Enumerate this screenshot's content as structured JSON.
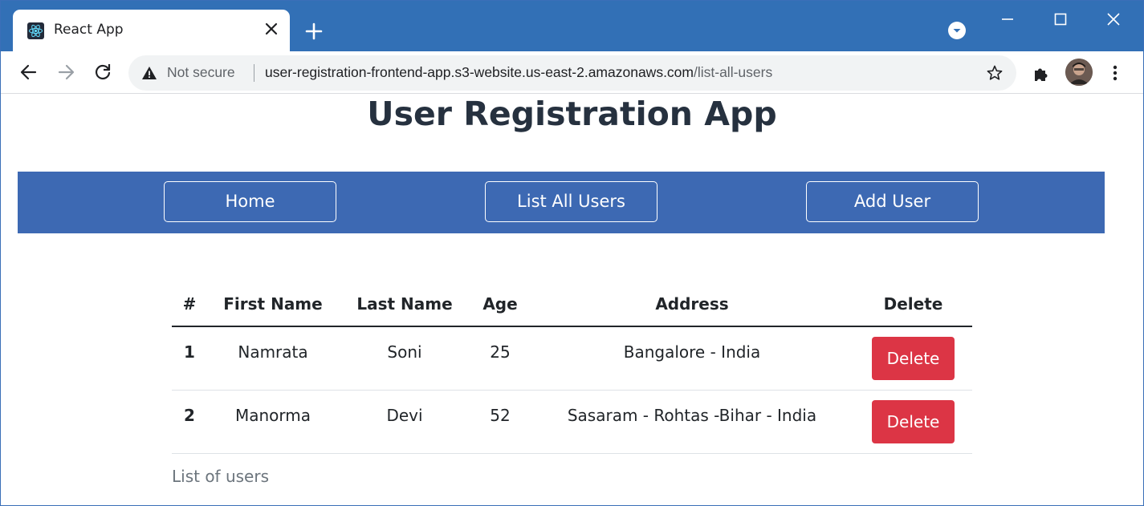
{
  "browser": {
    "tab_title": "React App",
    "security_label": "Not secure",
    "url_host": "user-registration-frontend-app.s3-website.us-east-2.amazonaws.com",
    "url_path": "/list-all-users",
    "accent_color": "#3270b6"
  },
  "page": {
    "title": "User Registration App",
    "nav": [
      {
        "label": "Home"
      },
      {
        "label": "List All Users"
      },
      {
        "label": "Add User"
      }
    ],
    "table": {
      "headers": [
        "#",
        "First Name",
        "Last Name",
        "Age",
        "Address",
        "Delete"
      ],
      "rows": [
        {
          "id": "1",
          "first_name": "Namrata",
          "last_name": "Soni",
          "age": "25",
          "address": "Bangalore - India",
          "action": "Delete"
        },
        {
          "id": "2",
          "first_name": "Manorma",
          "last_name": "Devi",
          "age": "52",
          "address": "Sasaram - Rohtas -Bihar - India",
          "action": "Delete"
        }
      ],
      "caption": "List of users"
    },
    "colors": {
      "navbar": "#3d69b3",
      "delete_button": "#dc3545",
      "title_text": "#26313f"
    }
  }
}
